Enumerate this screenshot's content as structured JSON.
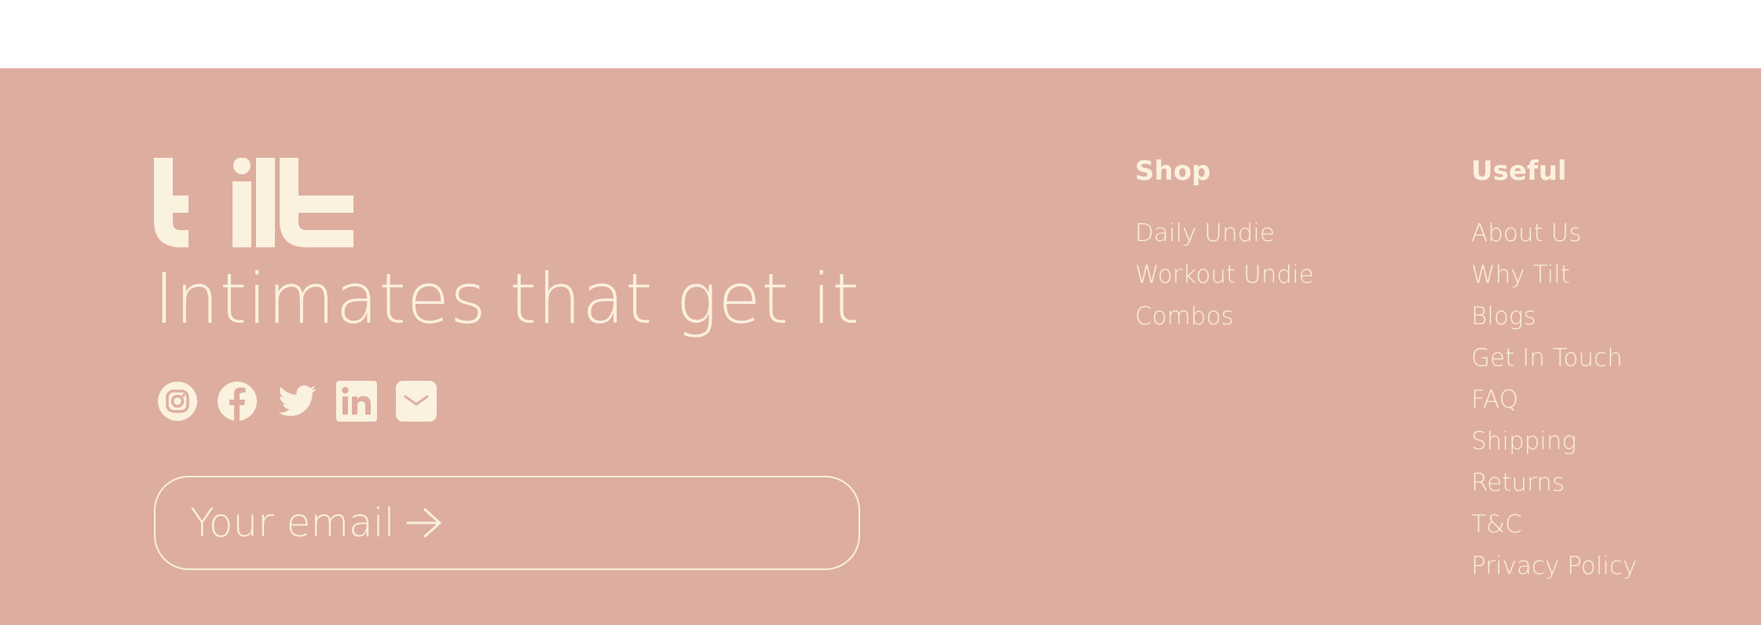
{
  "colors": {
    "footer_background": "#ddad9f",
    "foreground": "#fbf1df",
    "page_background": "#ffffff"
  },
  "brand": {
    "logo_text": "tilt",
    "tagline": "Intimates that get it"
  },
  "socials": [
    {
      "icon": "instagram-icon"
    },
    {
      "icon": "facebook-icon"
    },
    {
      "icon": "twitter-icon"
    },
    {
      "icon": "linkedin-icon"
    },
    {
      "icon": "email-icon"
    }
  ],
  "newsletter": {
    "placeholder": "Your email",
    "submit_icon": "arrow-right-icon"
  },
  "shop": {
    "title": "Shop",
    "links": [
      "Daily Undie",
      "Workout Undie",
      "Combos"
    ]
  },
  "useful": {
    "title": "Useful",
    "links": [
      "About Us",
      "Why Tilt",
      "Blogs",
      "Get In Touch",
      "FAQ",
      "Shipping",
      "Returns",
      "T&C",
      "Privacy Policy"
    ]
  }
}
